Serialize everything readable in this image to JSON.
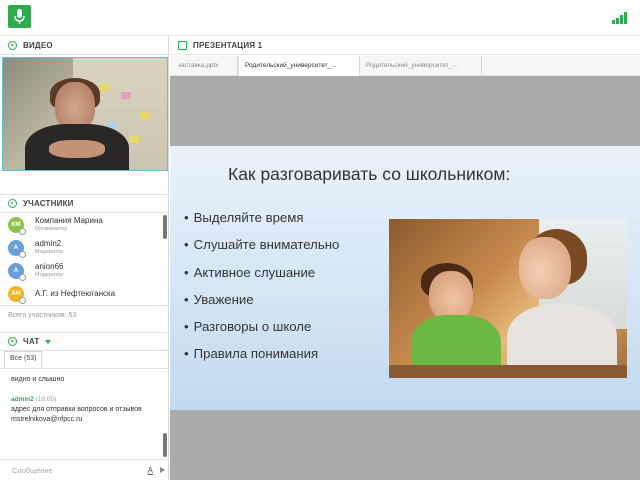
{
  "topbar": {
    "logo_icon": "microphone-icon",
    "signal_icon": "signal-icon",
    "accent": "#2eaa4f"
  },
  "video_panel": {
    "title": "ВИДЕО"
  },
  "participants_panel": {
    "title": "УЧАСТНИКИ",
    "items": [
      {
        "initials": "КМ",
        "name": "Компания Марина",
        "role": "Организатор",
        "color": "#8bc34a"
      },
      {
        "initials": "A",
        "name": "admin2",
        "role": "Модератор",
        "color": "#6b9fd8"
      },
      {
        "initials": "A",
        "name": "anion66",
        "role": "Модератор",
        "color": "#6b9fd8"
      },
      {
        "initials": "АН",
        "name": "А.Г. из Нефтеюганска",
        "role": "",
        "color": "#f0b429"
      }
    ],
    "total_text": "Всего участников: 53"
  },
  "chat_panel": {
    "title": "ЧАТ",
    "tab_all": "Все (53)",
    "messages": [
      {
        "author": "",
        "time": "",
        "text": "видно и слышно"
      },
      {
        "author": "admin2",
        "time": "(10:05)",
        "text": "адрес для отправки вопросов и отзывов mstrelnikova@nfpcc.ru"
      }
    ],
    "input_placeholder": "Сообщение",
    "format_label": "A"
  },
  "presentation_panel": {
    "title": "ПРЕЗЕНТАЦИЯ 1",
    "tabs": [
      {
        "label": "заставка.pptx",
        "active": false
      },
      {
        "label": "Родительский_университет_...",
        "active": true
      },
      {
        "label": "Родительский_университет_...",
        "active": false
      }
    ],
    "slide": {
      "title": "Как разговаривать со школьником:",
      "bullets": [
        "Выделяйте время",
        "Слушайте внимательно",
        "Активное слушание",
        "Уважение",
        "Разговоры о школе",
        "Правила понимания"
      ]
    }
  }
}
